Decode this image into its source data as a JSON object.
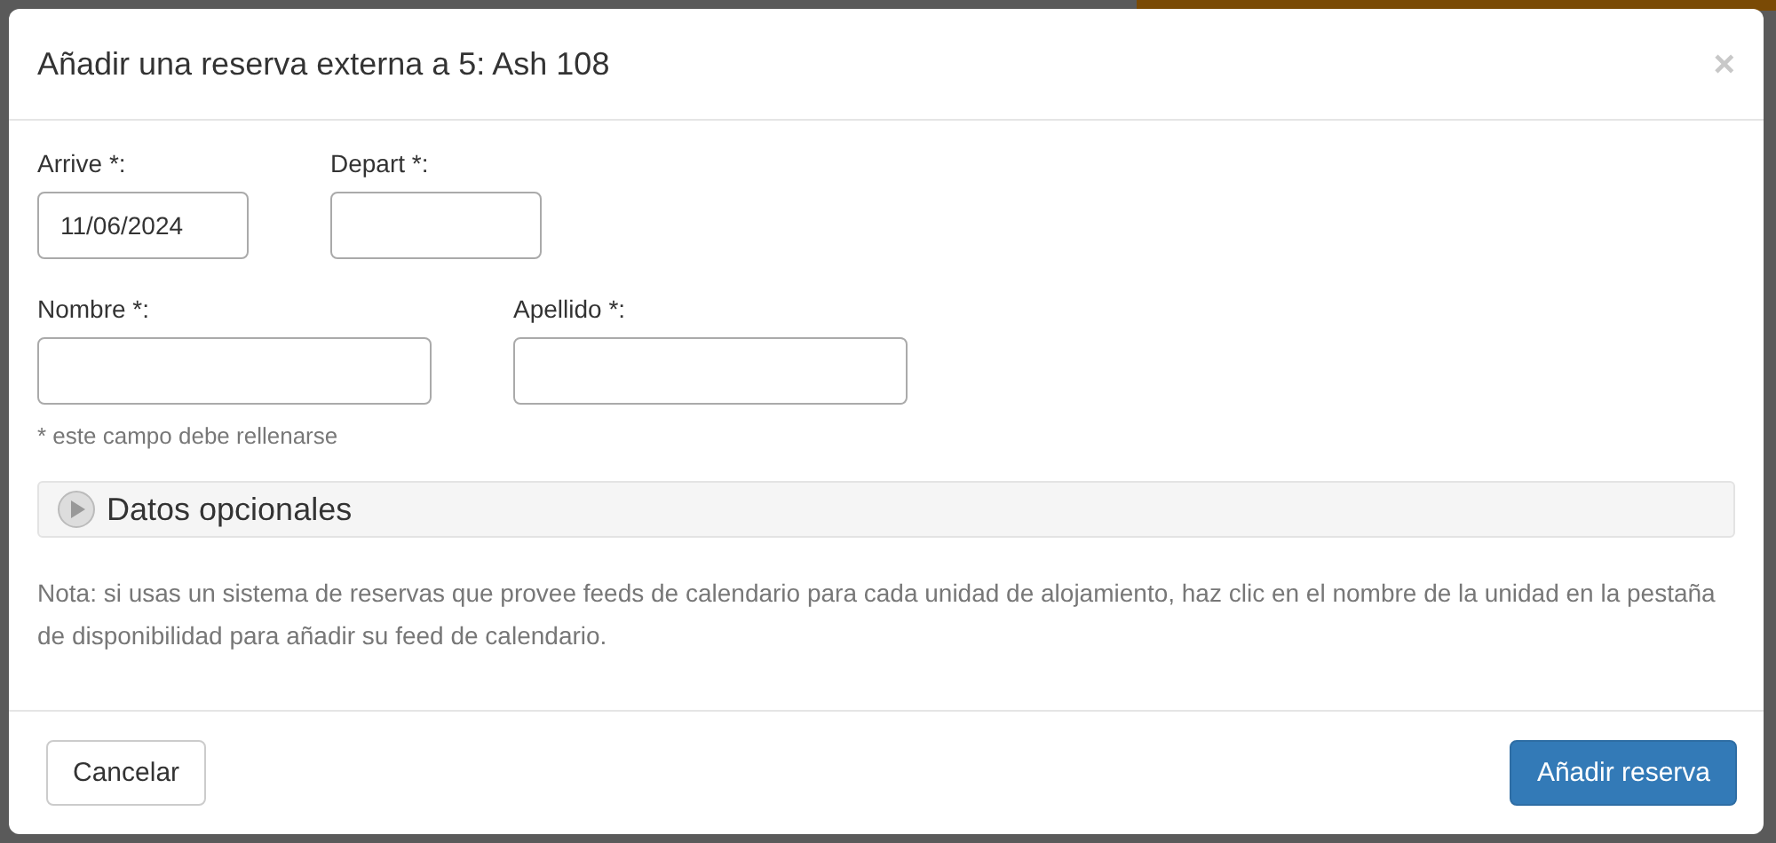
{
  "dialog": {
    "title": "Añadir una reserva externa a 5: Ash 108",
    "close": "×",
    "rows": [
      {
        "fields": [
          {
            "label": "Arrive *:",
            "value": "11/06/2024"
          },
          {
            "label": "Depart *:"
          }
        ]
      },
      {
        "fields": [
          {
            "label": "Nombre *:"
          },
          {
            "label": "Apellido *:"
          }
        ]
      }
    ],
    "required_note": "* este campo debe rellenarse",
    "optional_section": {
      "label": "Datos opcionales",
      "expanded": false
    },
    "note": "Nota: si usas un sistema de reservas que provee feeds de calendario para cada unidad de alojamiento, haz clic en el nombre de la unidad en la pestaña de disponibilidad para añadir su feed de calendario.",
    "buttons": [
      {
        "label": "Cancelar",
        "kind": "default"
      },
      {
        "label": "Añadir reserva",
        "kind": "primary"
      }
    ]
  }
}
